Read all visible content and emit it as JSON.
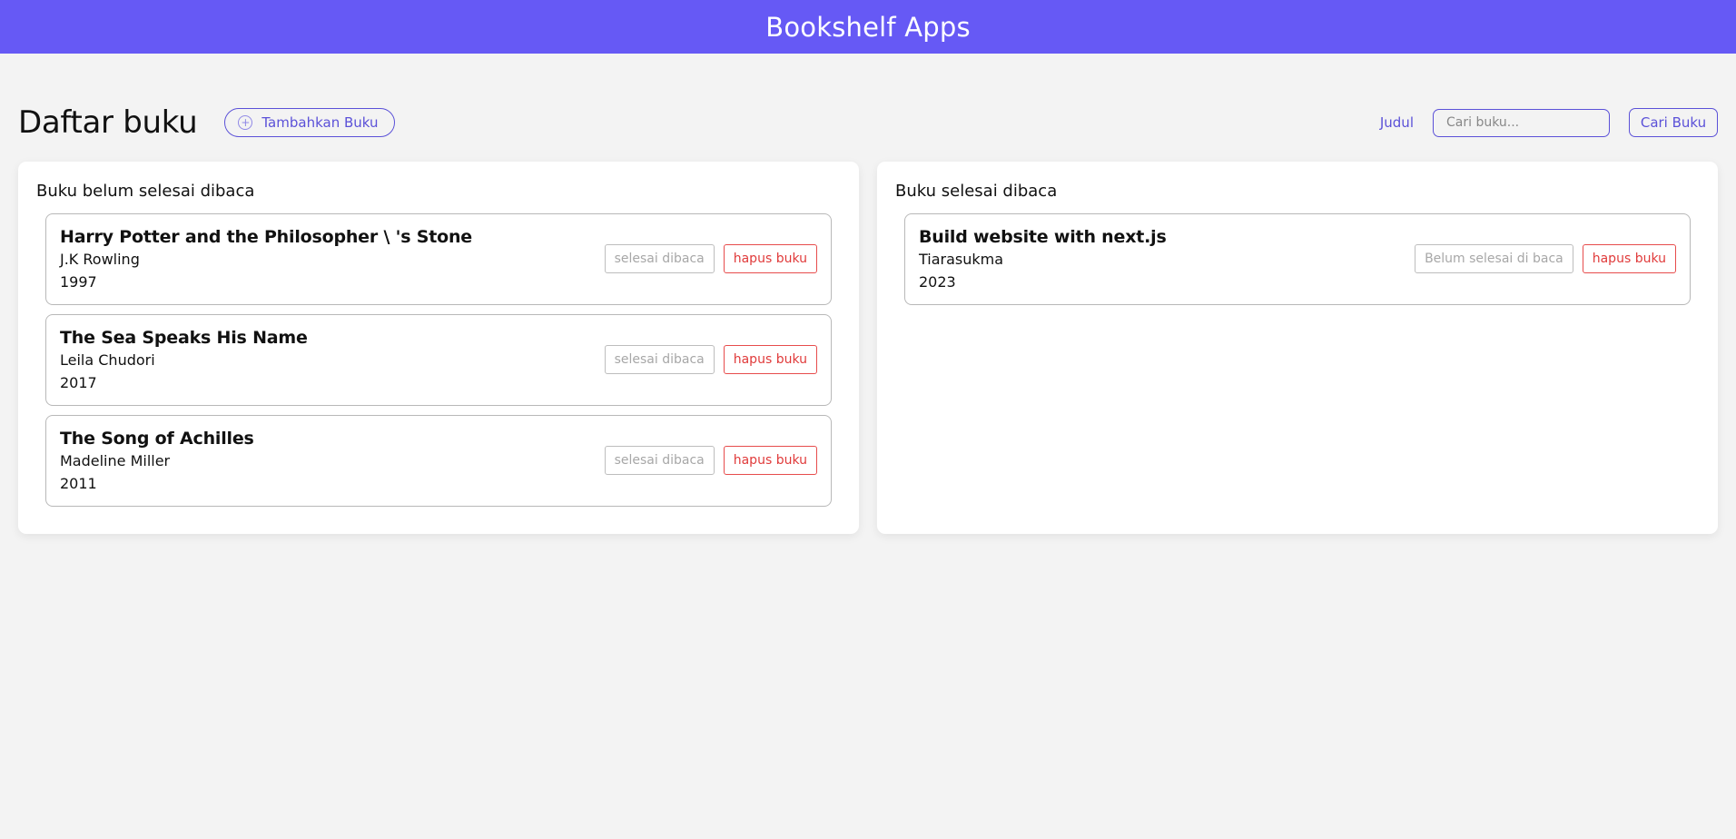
{
  "header": {
    "title": "Bookshelf Apps"
  },
  "toolbar": {
    "page_title": "Daftar buku",
    "add_button": "Tambahkan Buku",
    "search_label": "Judul",
    "search_placeholder": "Cari buku...",
    "search_value": "",
    "search_button": "Cari Buku"
  },
  "unread": {
    "title": "Buku belum selesai dibaca",
    "books": [
      {
        "title": "Harry Potter and the Philosopher \\ 's Stone",
        "author": "J.K Rowling",
        "year": "1997",
        "status_button": "selesai dibaca",
        "delete_button": "hapus buku"
      },
      {
        "title": "The Sea Speaks His Name",
        "author": "Leila Chudori",
        "year": "2017",
        "status_button": "selesai dibaca",
        "delete_button": "hapus buku"
      },
      {
        "title": "The Song of Achilles",
        "author": "Madeline Miller",
        "year": "2011",
        "status_button": "selesai dibaca",
        "delete_button": "hapus buku"
      }
    ]
  },
  "read": {
    "title": "Buku selesai dibaca",
    "books": [
      {
        "title": "Build website with next.js",
        "author": "Tiarasukma",
        "year": "2023",
        "status_button": "Belum selesai di baca",
        "delete_button": "hapus buku"
      }
    ]
  },
  "colors": {
    "header_bg": "#6659f5",
    "accent": "#5b51d8",
    "danger": "#e03a3a",
    "page_bg": "#f3f3f3"
  }
}
